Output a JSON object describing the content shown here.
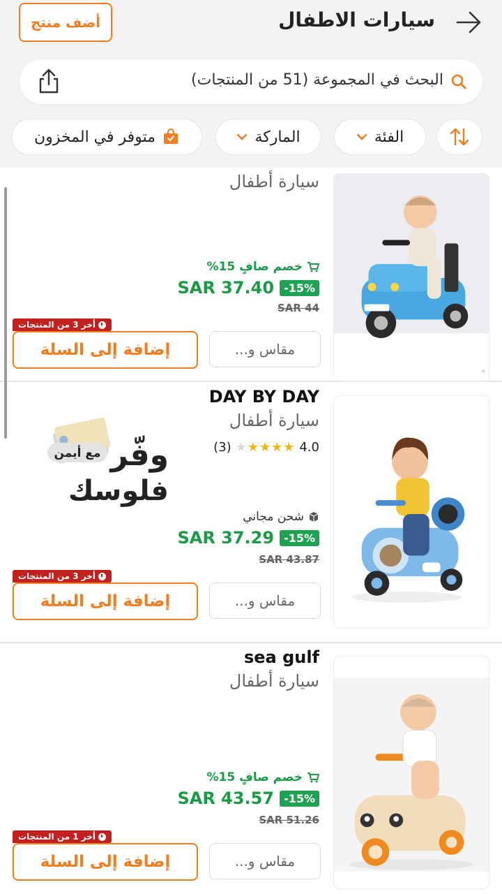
{
  "header": {
    "title": "سيارات الاطفال",
    "add_product": "أضف منتج",
    "search_placeholder": "البحث في المجموعة (51 من المنتجات)"
  },
  "filters": {
    "category": "الفئة",
    "brand": "الماركة",
    "in_stock": "متوفر في المخزون"
  },
  "products": [
    {
      "name": "سيارة أطفال",
      "promo": "خصم صافٍ 15%",
      "discount": "15%-",
      "price": "SAR 37.40",
      "old_price": "SAR 44",
      "stock": "أخر 3 من المنتجات",
      "size": "مقاس و...",
      "cart": "إضافة إلى السلة"
    },
    {
      "brand": "DAY BY DAY",
      "name": "سيارة أطفال",
      "rating": "4.0",
      "reviews": "(3)",
      "stars": 4,
      "shipping": "شحن مجاني",
      "discount": "15%-",
      "price": "SAR 37.29",
      "old_price": "SAR 43.87",
      "stock": "أخر 3 من المنتجات",
      "size": "مقاس و...",
      "cart": "إضافة إلى السلة",
      "ad": {
        "line1": "وفّر",
        "line2": "فلوسك",
        "badge": "مع أيمن"
      }
    },
    {
      "brand": "sea gulf",
      "name": "سيارة أطفال",
      "promo": "خصم صافٍ 15%",
      "discount": "15%-",
      "price": "SAR 43.57",
      "old_price": "SAR 51.26",
      "stock": "أخر 1 من المنتجات",
      "size": "مقاس و...",
      "cart": "إضافة إلى السلة"
    }
  ],
  "colors": {
    "accent": "#f07d1f",
    "green": "#1b9a47",
    "red_tag": "#c21f1f",
    "header_bg": "#f3f3f3"
  }
}
